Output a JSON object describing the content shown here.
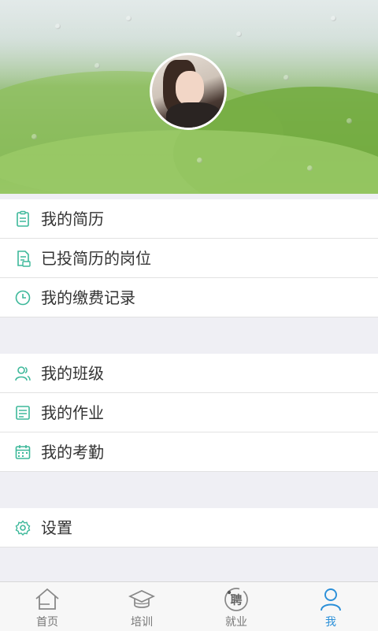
{
  "colors": {
    "accent": "#2a8fd8",
    "icon_green": "#3db89a"
  },
  "menu_groups": [
    {
      "items": [
        {
          "label": "我的简历",
          "icon": "resume-icon"
        },
        {
          "label": "已投简历的岗位",
          "icon": "applied-jobs-icon"
        },
        {
          "label": "我的缴费记录",
          "icon": "clock-icon"
        }
      ]
    },
    {
      "items": [
        {
          "label": "我的班级",
          "icon": "people-icon"
        },
        {
          "label": "我的作业",
          "icon": "homework-icon"
        },
        {
          "label": "我的考勤",
          "icon": "calendar-icon"
        }
      ]
    },
    {
      "items": [
        {
          "label": "设置",
          "icon": "gear-icon"
        }
      ]
    }
  ],
  "tabs": [
    {
      "label": "首页",
      "icon": "home-icon",
      "active": false
    },
    {
      "label": "培训",
      "icon": "graduation-cap-icon",
      "active": false
    },
    {
      "label": "就业",
      "icon": "hire-badge-icon",
      "badge_text": "聘",
      "active": false
    },
    {
      "label": "我",
      "icon": "person-icon",
      "active": true
    }
  ]
}
